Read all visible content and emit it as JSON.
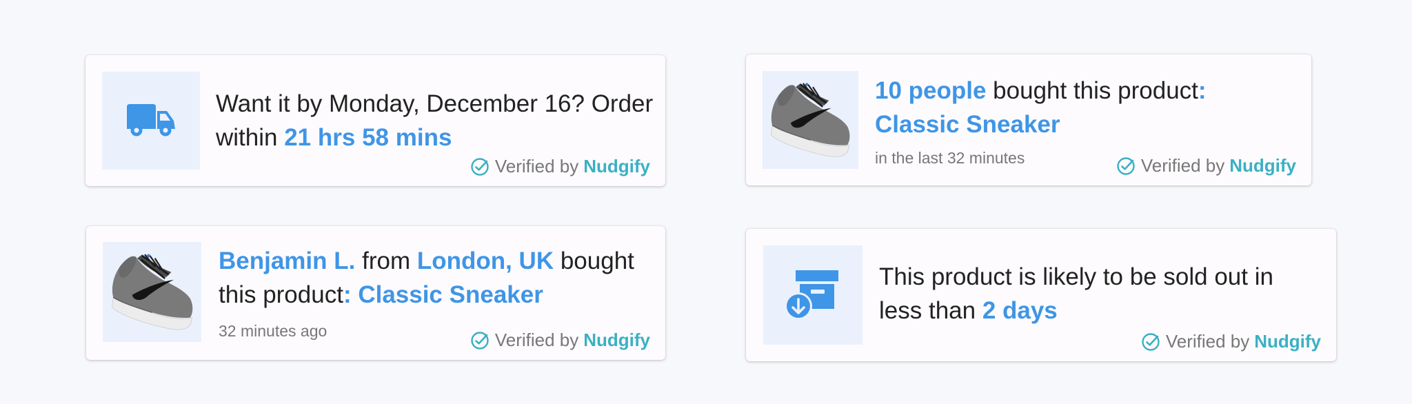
{
  "colors": {
    "accent": "#3f95e6",
    "brand": "#3ab0c3",
    "thumb_bg": "#eaf1fd",
    "text": "#222222",
    "muted": "#777777"
  },
  "cards": [
    {
      "icon": "delivery-truck-icon",
      "text_before": "Want it by Monday, December 16? Order within ",
      "highlight": "21 hrs 58 mins",
      "verified_label": "Verified by",
      "brand": "Nudgify"
    },
    {
      "image": "sneaker-image",
      "count": "10 people",
      "text_mid": " bought this product",
      "product": ": Classic Sneaker",
      "subtext": "in the last 32 minutes",
      "verified_label": "Verified by",
      "brand": "Nudgify"
    },
    {
      "image": "sneaker-image",
      "name": "Benjamin L.",
      "from": " from ",
      "location": "London, UK",
      "text_mid": " bought this product",
      "product": ": Classic Sneaker",
      "subtext": "32 minutes ago",
      "verified_label": "Verified by",
      "brand": "Nudgify"
    },
    {
      "icon": "archive-box-icon",
      "text_before": "This product is likely to be sold out in less than ",
      "highlight": "2 days",
      "verified_label": "Verified by",
      "brand": "Nudgify"
    }
  ]
}
